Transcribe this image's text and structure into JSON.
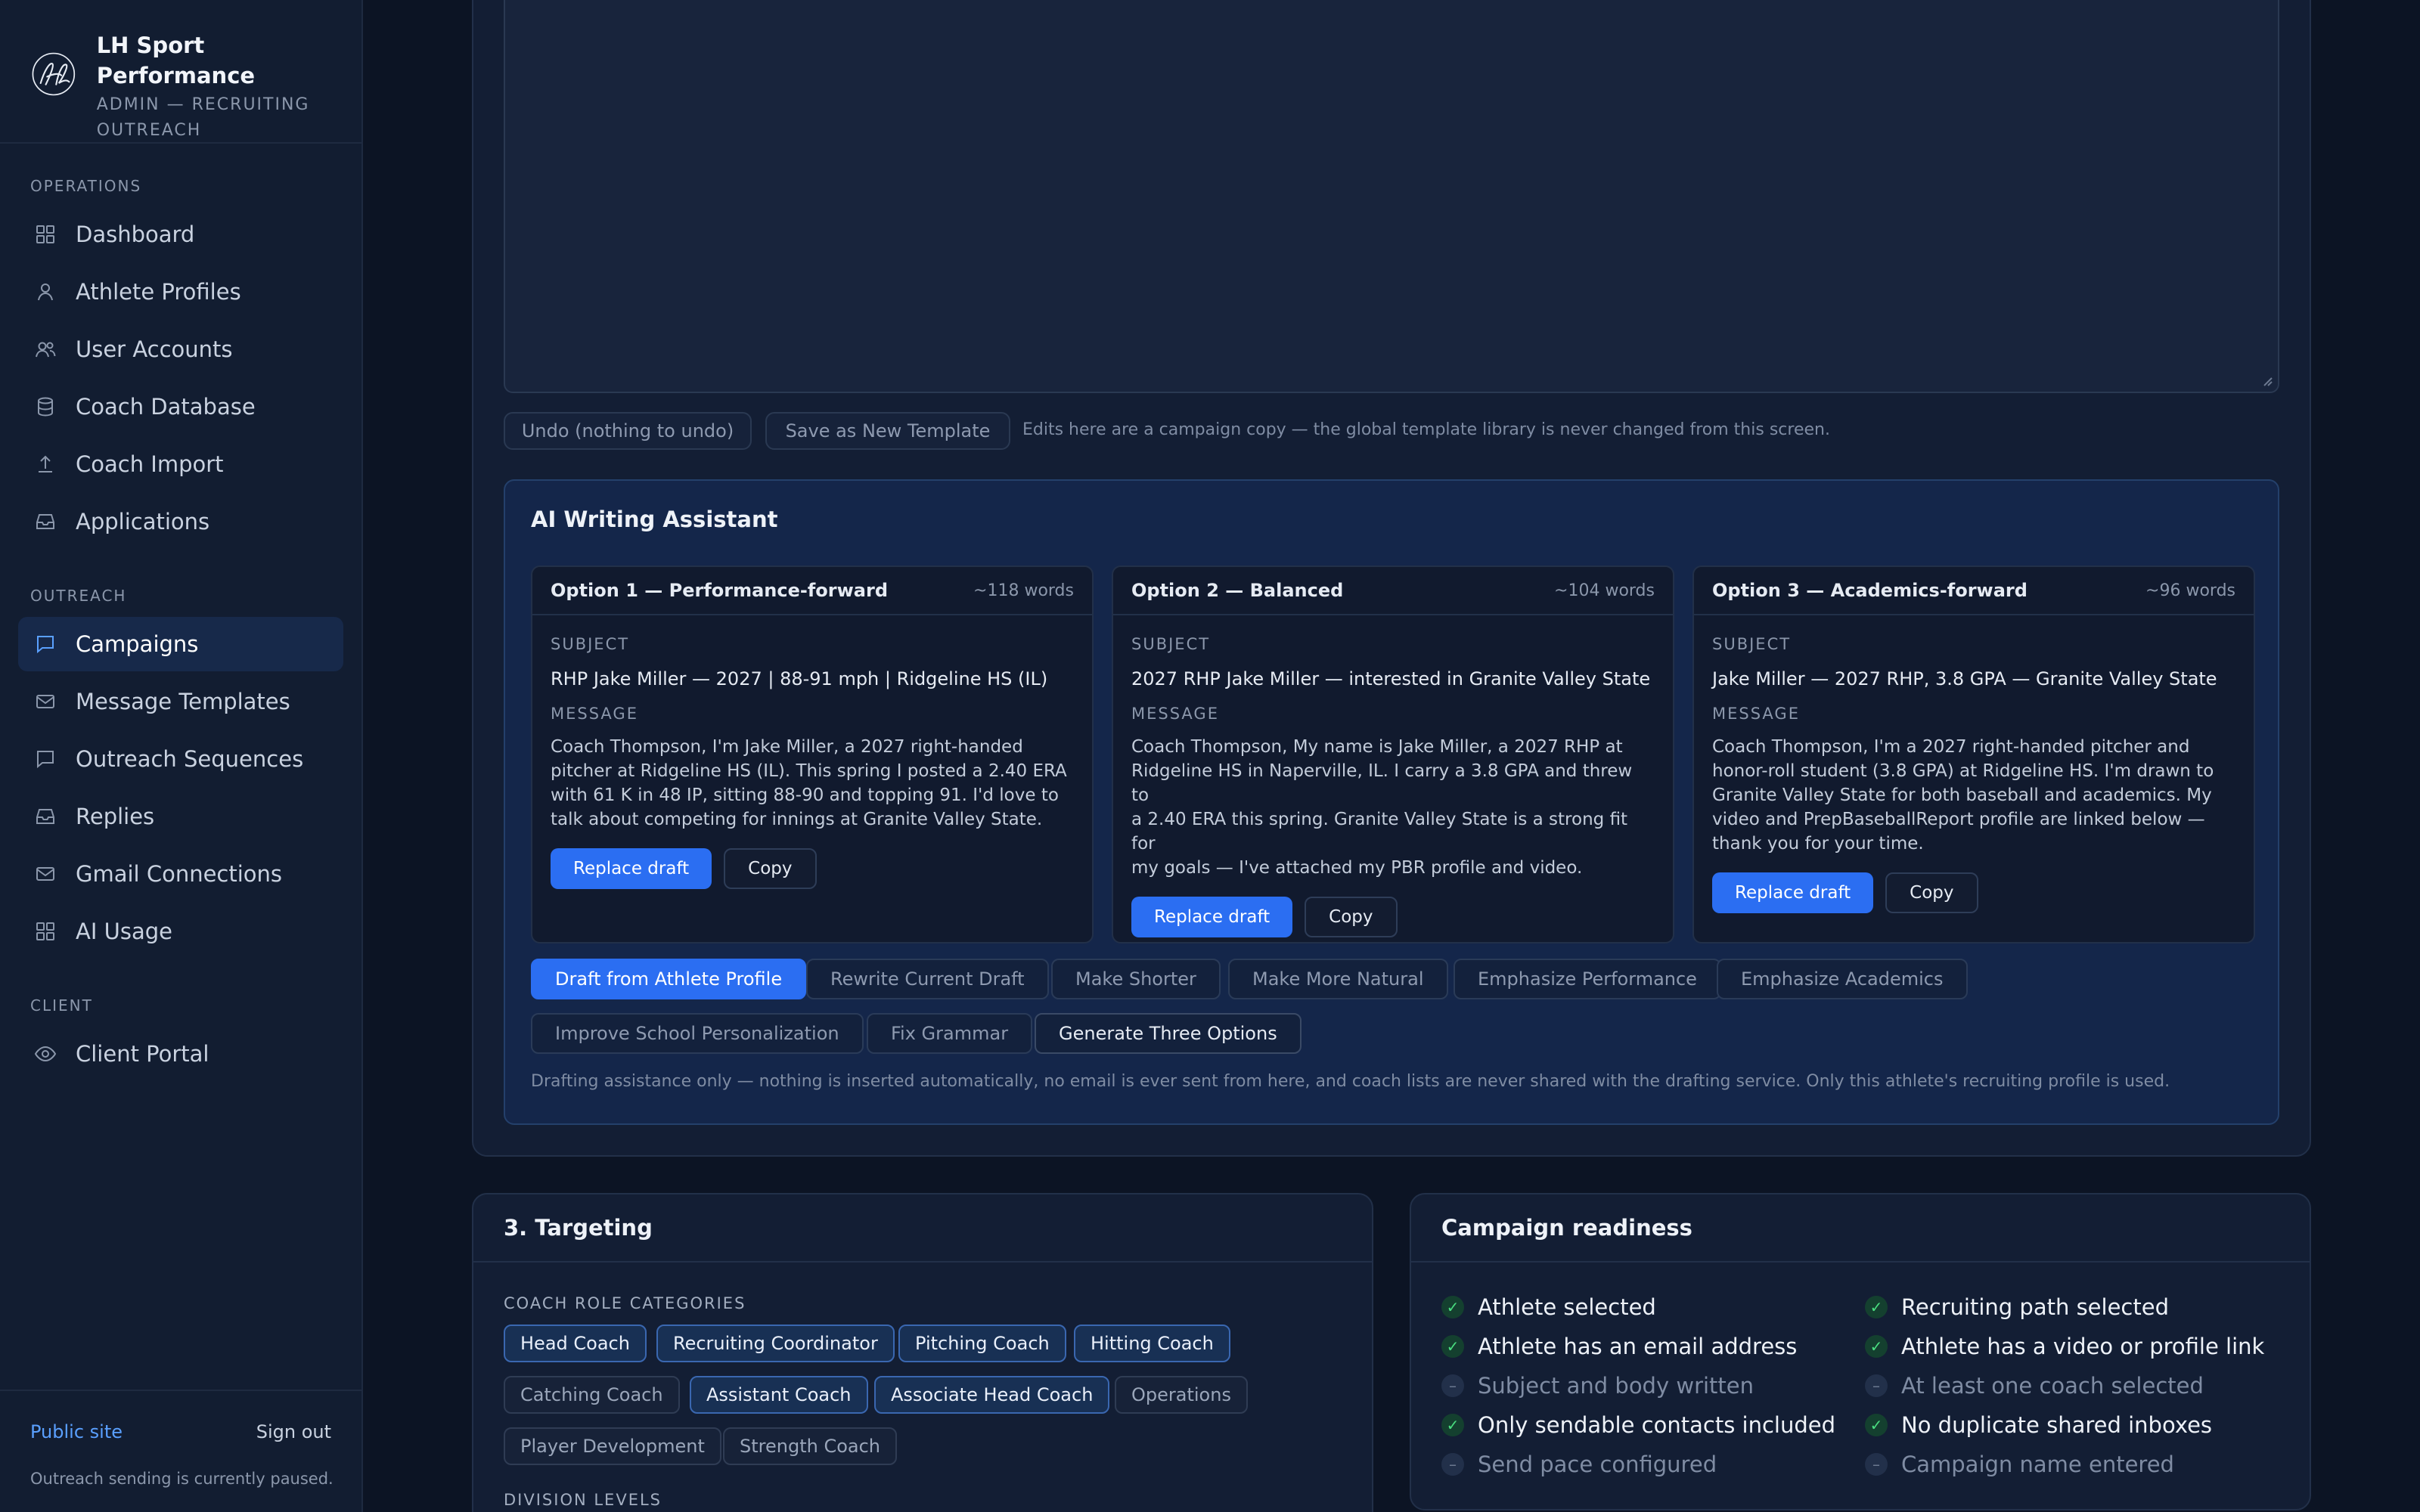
{
  "brand": {
    "name": "LH Sport Performance",
    "subtitle_line1": "ADMIN — RECRUITING",
    "subtitle_line2": "OUTREACH"
  },
  "sidebar": {
    "sections": [
      {
        "label": "OPERATIONS"
      },
      {
        "label": "OUTREACH"
      },
      {
        "label": "CLIENT"
      }
    ],
    "items": [
      {
        "label": "Dashboard",
        "icon": "grid-icon"
      },
      {
        "label": "Athlete Profiles",
        "icon": "user-icon"
      },
      {
        "label": "User Accounts",
        "icon": "users-icon"
      },
      {
        "label": "Coach Database",
        "icon": "database-icon"
      },
      {
        "label": "Coach Import",
        "icon": "upload-icon"
      },
      {
        "label": "Applications",
        "icon": "inbox-icon"
      },
      {
        "label": "Campaigns",
        "icon": "message-icon",
        "active": true
      },
      {
        "label": "Message Templates",
        "icon": "mail-icon"
      },
      {
        "label": "Outreach Sequences",
        "icon": "message-icon"
      },
      {
        "label": "Replies",
        "icon": "inbox-icon"
      },
      {
        "label": "Gmail Connections",
        "icon": "mail-icon"
      },
      {
        "label": "AI Usage",
        "icon": "grid-icon"
      },
      {
        "label": "Client Portal",
        "icon": "eye-icon"
      }
    ],
    "public_site": "Public site",
    "sign_out": "Sign out",
    "paused_note": "Outreach sending is currently paused."
  },
  "editor": {
    "undo_label": "Undo (nothing to undo)",
    "save_template_label": "Save as New Template",
    "campaign_note": "Edits here are a campaign copy — the global template library is never changed from this screen."
  },
  "ai": {
    "title": "AI Writing Assistant",
    "subject_label": "SUBJECT",
    "message_label": "MESSAGE",
    "replace_label": "Replace draft",
    "copy_label": "Copy",
    "options": [
      {
        "name": "Option 1 — Performance-forward",
        "words": "~118 words",
        "subject": "RHP Jake Miller — 2027 | 88-91 mph | Ridgeline HS (IL)",
        "message_lines": [
          "Coach Thompson, I'm Jake Miller, a 2027 right-handed",
          "pitcher at Ridgeline HS (IL). This spring I posted a 2.40 ERA",
          "with 61 K in 48 IP, sitting 88-90 and topping 91. I'd love to",
          "talk about competing for innings at Granite Valley State."
        ]
      },
      {
        "name": "Option 2 — Balanced",
        "words": "~104 words",
        "subject": "2027 RHP Jake Miller — interested in Granite Valley State",
        "message_lines": [
          "Coach Thompson, My name is Jake Miller, a 2027 RHP at",
          "Ridgeline HS in Naperville, IL. I carry a 3.8 GPA and threw to",
          "a 2.40 ERA this spring. Granite Valley State is a strong fit for",
          "my goals — I've attached my PBR profile and video."
        ]
      },
      {
        "name": "Option 3 — Academics-forward",
        "words": "~96 words",
        "subject": "Jake Miller — 2027 RHP, 3.8 GPA — Granite Valley State",
        "message_lines": [
          "Coach Thompson, I'm a 2027 right-handed pitcher and",
          "honor-roll student (3.8 GPA) at Ridgeline HS. I'm drawn to",
          "Granite Valley State for both baseball and academics. My",
          "video and PrepBaseballReport profile are linked below —",
          "thank you for your time."
        ]
      }
    ],
    "actions_row1": [
      "Draft from Athlete Profile",
      "Rewrite Current Draft",
      "Make Shorter",
      "Make More Natural",
      "Emphasize Performance",
      "Emphasize Academics"
    ],
    "actions_row2": [
      "Improve School Personalization",
      "Fix Grammar",
      "Generate Three Options"
    ],
    "disclaimer": "Drafting assistance only — nothing is inserted automatically, no email is ever sent from here, and coach lists are never shared with the drafting service. Only this athlete's recruiting profile is used."
  },
  "targeting": {
    "title": "3. Targeting",
    "roles_label": "COACH ROLE CATEGORIES",
    "roles": [
      {
        "label": "Head Coach",
        "selected": true
      },
      {
        "label": "Recruiting Coordinator",
        "selected": true
      },
      {
        "label": "Pitching Coach",
        "selected": true
      },
      {
        "label": "Hitting Coach",
        "selected": true
      },
      {
        "label": "Catching Coach",
        "selected": false
      },
      {
        "label": "Assistant Coach",
        "selected": true
      },
      {
        "label": "Associate Head Coach",
        "selected": true
      },
      {
        "label": "Operations",
        "selected": false
      },
      {
        "label": "Player Development",
        "selected": false
      },
      {
        "label": "Strength Coach",
        "selected": false
      }
    ],
    "division_label": "DIVISION LEVELS"
  },
  "readiness": {
    "title": "Campaign readiness",
    "items": [
      {
        "label": "Athlete selected",
        "done": true
      },
      {
        "label": "Recruiting path selected",
        "done": true
      },
      {
        "label": "Athlete has an email address",
        "done": true
      },
      {
        "label": "Athlete has a video or profile link",
        "done": true
      },
      {
        "label": "Subject and body written",
        "done": false
      },
      {
        "label": "At least one coach selected",
        "done": false
      },
      {
        "label": "Only sendable contacts included",
        "done": true
      },
      {
        "label": "No duplicate shared inboxes",
        "done": true
      },
      {
        "label": "Send pace configured",
        "done": false
      },
      {
        "label": "Campaign name entered",
        "done": false
      }
    ],
    "check_glyph": "✓",
    "pending_glyph": "–"
  },
  "colors": {
    "accent": "#2b6ef2",
    "link": "#5aa0ff",
    "success": "#4ade80",
    "background": "#0c1424"
  }
}
